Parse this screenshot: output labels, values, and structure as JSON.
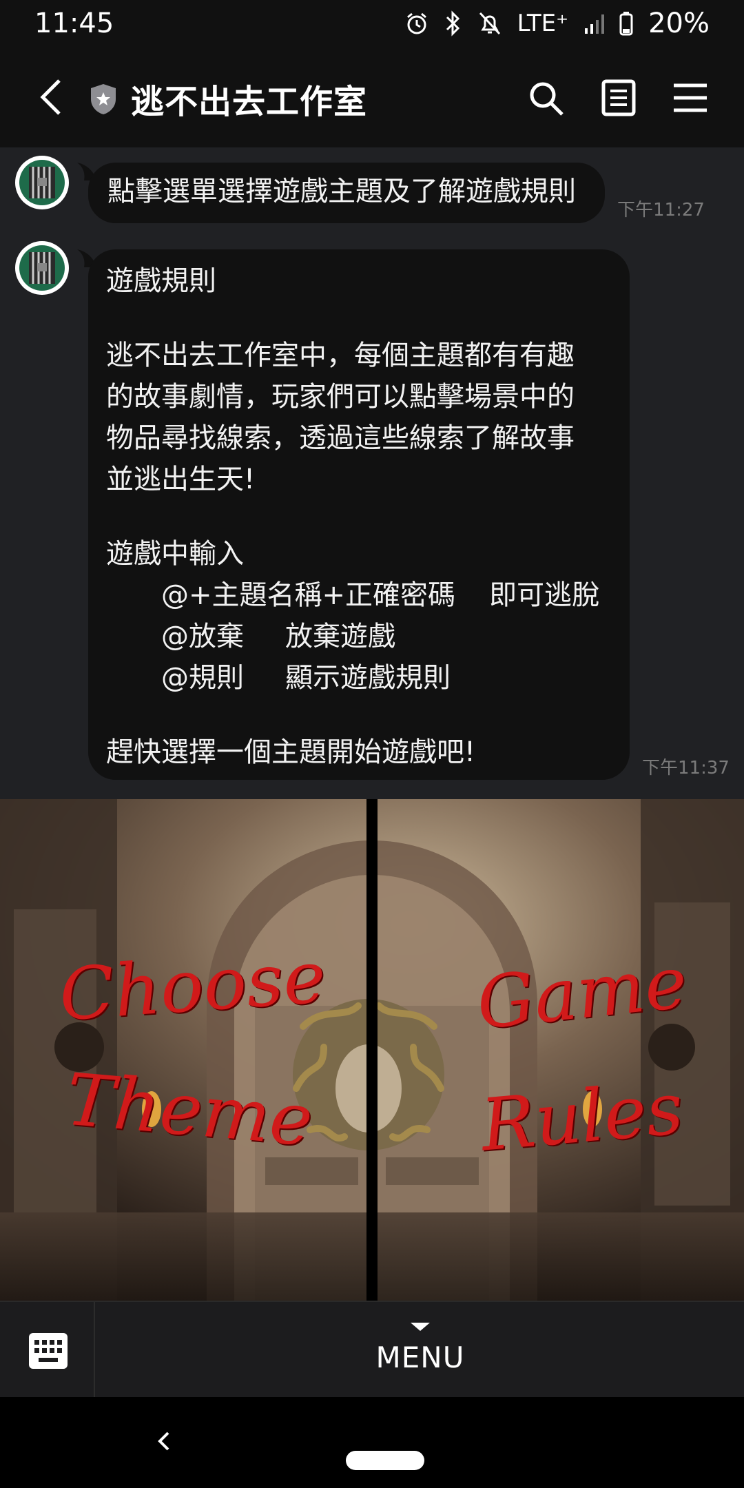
{
  "status_bar": {
    "time": "11:45",
    "network": "LTE⁺",
    "battery": "20%",
    "icons": [
      "alarm-icon",
      "bluetooth-icon",
      "mute-icon",
      "signal-icon",
      "battery-icon"
    ]
  },
  "header": {
    "title": "逃不出去工作室",
    "icons": [
      "back-arrow-icon",
      "shield-icon",
      "search-icon",
      "notes-icon",
      "menu-icon"
    ]
  },
  "messages": [
    {
      "text": "點擊選單選擇遊戲主題及了解遊戲規則",
      "time": "下午11:27"
    },
    {
      "heading": "遊戲規則",
      "paragraph": [
        "逃不出去工作室中，每個主題都有有趣",
        "的故事劇情，玩家們可以點擊場景中的",
        "物品尋找線索，透過這些線索了解故事",
        "並逃出生天!"
      ],
      "commands_title": "遊戲中輸入",
      "commands": [
        {
          "cmd": "@+主題名稱+正確密碼",
          "desc": "即可逃脫"
        },
        {
          "cmd": "@放棄",
          "desc": "放棄遊戲"
        },
        {
          "cmd": "@規則",
          "desc": "顯示遊戲規則"
        }
      ],
      "closing": "趕快選擇一個主題開始遊戲吧!",
      "time": "下午11:37"
    }
  ],
  "rich_menu": {
    "left_button": {
      "line1": "Choose",
      "line2": "Theme"
    },
    "right_button": {
      "line1": "Game",
      "line2": "Rules"
    },
    "colors": {
      "text": "#d11a1a",
      "background": "#3a2e26"
    }
  },
  "bottom_bar": {
    "menu_label": "MENU",
    "icons": [
      "keyboard-icon",
      "triangle-down-icon"
    ]
  }
}
